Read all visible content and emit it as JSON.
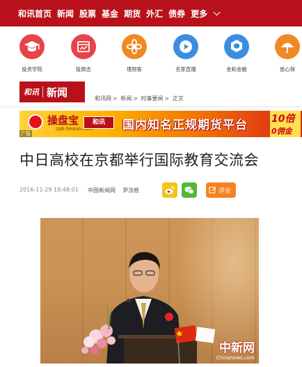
{
  "colors": {
    "brand_red": "#b8111b",
    "accent_orange": "#f6821f"
  },
  "nav": {
    "items": [
      "和讯首页",
      "新闻",
      "股票",
      "基金",
      "期货",
      "外汇",
      "债券"
    ],
    "more_label": "更多"
  },
  "quick_links": [
    {
      "label": "投资学院",
      "icon": "graduation-cap-icon",
      "color": "#e8434a"
    },
    {
      "label": "投顾志",
      "icon": "chart-window-icon",
      "color": "#e8434a"
    },
    {
      "label": "理财客",
      "icon": "flower-icon",
      "color": "#f08a24"
    },
    {
      "label": "名家直播",
      "icon": "play-icon",
      "color": "#3c8de0"
    },
    {
      "label": "金和金融",
      "icon": "hexagon-icon",
      "color": "#3c8de0"
    },
    {
      "label": "放心保",
      "icon": "umbrella-icon",
      "color": "#f08a24"
    }
  ],
  "brand": {
    "hexun": "和讯",
    "news": "新闻"
  },
  "breadcrumb": [
    "和讯网",
    "新闻",
    "时事要闻",
    "正文"
  ],
  "ad": {
    "name": "操盘宝",
    "url": "cpb.hexun.com",
    "logo": "和讯",
    "slogan": "国内知名正规期货平台",
    "right_top": "10倍",
    "right_bottom": "0佣金",
    "tag": "广告"
  },
  "article": {
    "title": "中日高校在京都举行国际教育交流会",
    "datetime": "2016-11-29 18:48:01",
    "source": "中国新闻网",
    "author": "尹法根",
    "comment_label": "评论"
  },
  "photo": {
    "watermark_main": "中新网",
    "watermark_url": "Chinanews.com"
  }
}
